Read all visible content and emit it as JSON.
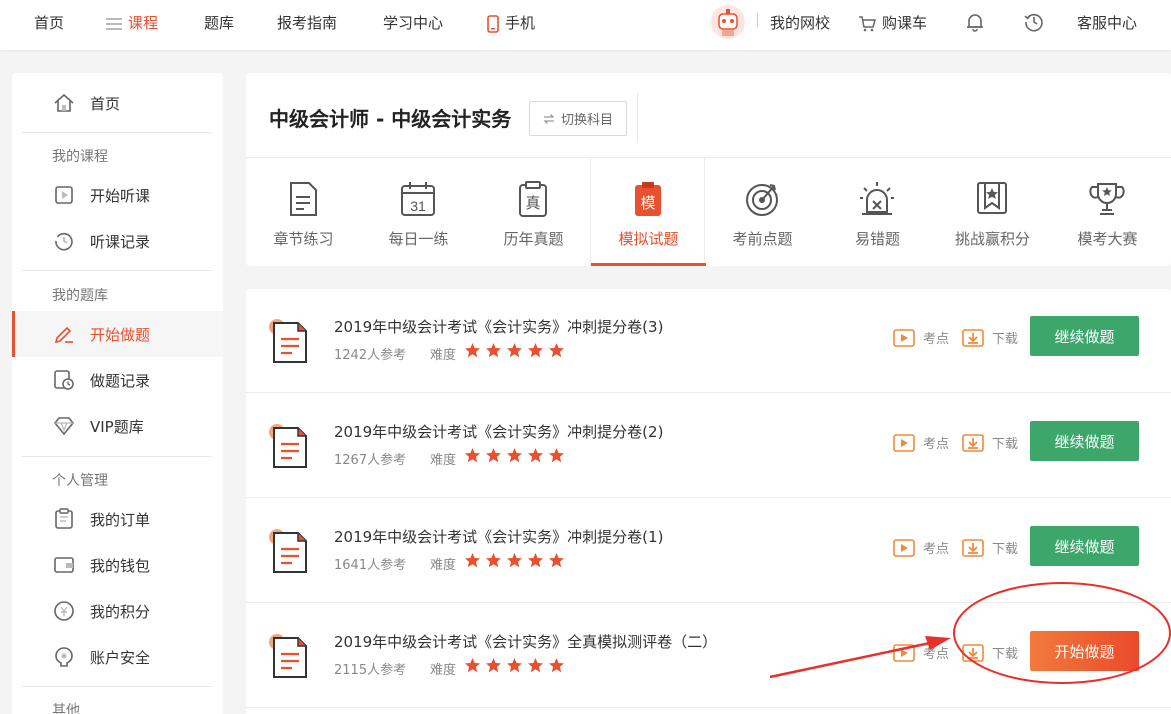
{
  "nav": {
    "home": "首页",
    "courses": "课程",
    "question_bank": "题库",
    "exam_guide": "报考指南",
    "study_center": "学习中心",
    "mobile": "手机",
    "my_school": "我的网校",
    "cart": "购课车",
    "service": "客服中心"
  },
  "sidebar": {
    "home": "首页",
    "my_courses_header": "我的课程",
    "start_listening": "开始听课",
    "listen_history": "听课记录",
    "my_bank_header": "我的题库",
    "start_practice": "开始做题",
    "practice_history": "做题记录",
    "vip_bank": "VIP题库",
    "personal_header": "个人管理",
    "my_orders": "我的订单",
    "my_wallet": "我的钱包",
    "my_points": "我的积分",
    "account_security": "账户安全",
    "other_header": "其他"
  },
  "header": {
    "subject_title": "中级会计师 - 中级会计实务",
    "switch_subject": "切换科目"
  },
  "tabs": [
    {
      "label": "章节练习",
      "icon": "document-icon"
    },
    {
      "label": "每日一练",
      "icon": "calendar-icon",
      "icon_text": "31"
    },
    {
      "label": "历年真题",
      "icon": "clipboard-icon",
      "icon_text": "真"
    },
    {
      "label": "模拟试题",
      "icon": "mock-icon",
      "icon_text": "模",
      "active": true
    },
    {
      "label": "考前点题",
      "icon": "target-icon"
    },
    {
      "label": "易错题",
      "icon": "alarm-icon"
    },
    {
      "label": "挑战赢积分",
      "icon": "bookmark-star-icon"
    },
    {
      "label": "模考大赛",
      "icon": "trophy-icon"
    }
  ],
  "exam_list": [
    {
      "title": "2019年中级会计考试《会计实务》冲刺提分卷(3)",
      "count": "1242人参考",
      "difficulty_label": "难度",
      "stars": 5,
      "points_label": "考点",
      "download_label": "下载",
      "button": "继续做题",
      "button_type": "green"
    },
    {
      "title": "2019年中级会计考试《会计实务》冲刺提分卷(2)",
      "count": "1267人参考",
      "difficulty_label": "难度",
      "stars": 5,
      "points_label": "考点",
      "download_label": "下载",
      "button": "继续做题",
      "button_type": "green"
    },
    {
      "title": "2019年中级会计考试《会计实务》冲刺提分卷(1)",
      "count": "1641人参考",
      "difficulty_label": "难度",
      "stars": 5,
      "points_label": "考点",
      "download_label": "下载",
      "button": "继续做题",
      "button_type": "green"
    },
    {
      "title": "2019年中级会计考试《会计实务》全真模拟测评卷（二）",
      "count": "2115人参考",
      "difficulty_label": "难度",
      "stars": 5,
      "points_label": "考点",
      "download_label": "下载",
      "button": "开始做题",
      "button_type": "orange"
    }
  ],
  "colors": {
    "accent": "#e8502f",
    "green_button": "#3ca66b",
    "annotation_red": "#e8302a"
  }
}
